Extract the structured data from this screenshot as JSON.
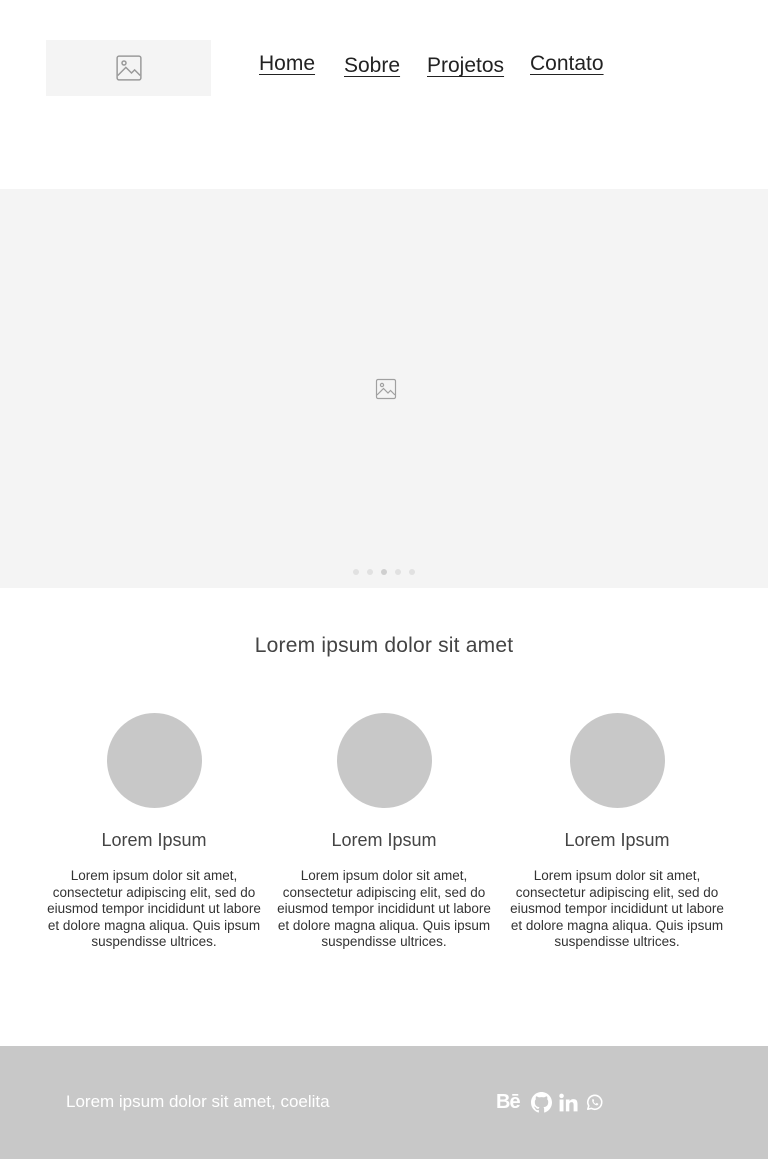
{
  "header": {
    "logo_icon": "image-placeholder-icon",
    "nav": [
      {
        "label": "Home"
      },
      {
        "label": "Sobre"
      },
      {
        "label": "Projetos"
      },
      {
        "label": "Contato"
      }
    ]
  },
  "hero": {
    "icon": "image-placeholder-icon",
    "slide_count": 5,
    "active_slide": 3
  },
  "features": {
    "title": "Lorem ipsum dolor sit amet",
    "items": [
      {
        "title": "Lorem Ipsum",
        "text": "Lorem ipsum dolor sit amet, consectetur adipiscing elit, sed do eiusmod tempor incididunt ut labore et dolore magna aliqua. Quis ipsum suspendisse ultrices."
      },
      {
        "title": "Lorem Ipsum",
        "text": "Lorem ipsum dolor sit amet, consectetur adipiscing elit, sed do eiusmod tempor incididunt ut labore et dolore magna aliqua. Quis ipsum suspendisse ultrices."
      },
      {
        "title": "Lorem Ipsum",
        "text": "Lorem ipsum dolor sit amet, consectetur adipiscing elit, sed do eiusmod tempor incididunt ut labore et dolore magna aliqua. Quis ipsum suspendisse ultrices."
      }
    ]
  },
  "footer": {
    "text": "Lorem ipsum dolor sit amet, coelita",
    "social": [
      {
        "icon": "behance-icon",
        "glyph": "Bē"
      },
      {
        "icon": "github-icon"
      },
      {
        "icon": "linkedin-icon"
      },
      {
        "icon": "whatsapp-icon"
      }
    ]
  },
  "colors": {
    "hero_bg": "#f4f4f4",
    "placeholder_gray": "#c8c8c8",
    "footer_bg": "#c8c8c8",
    "footer_text": "#ffffff"
  }
}
